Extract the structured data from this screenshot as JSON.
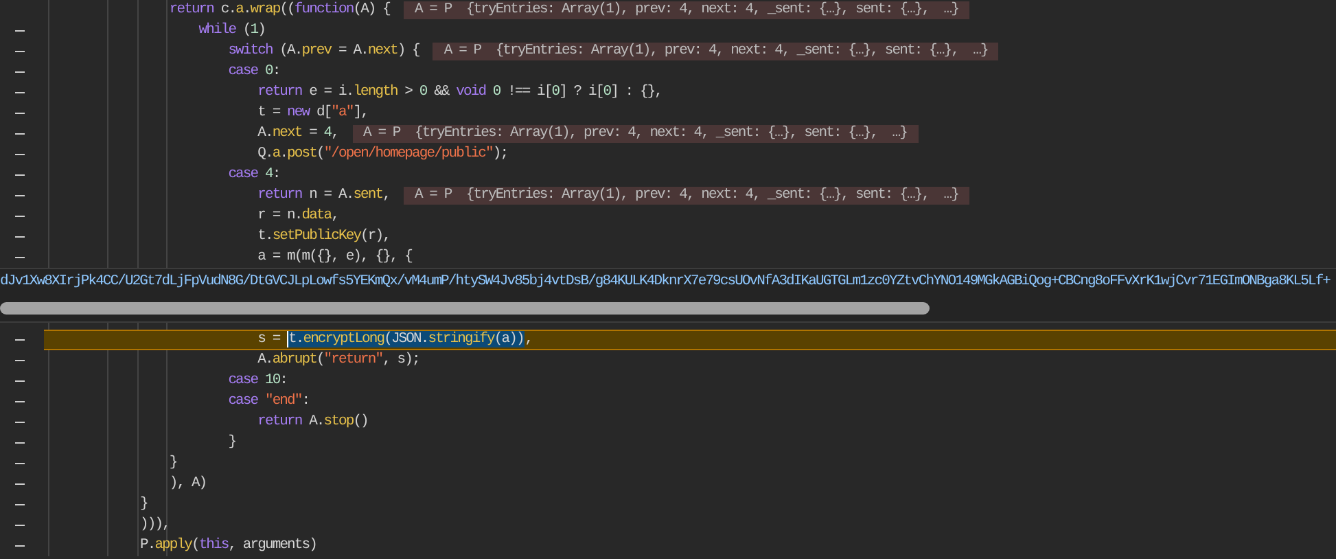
{
  "code_lines": [
    {
      "paused": false,
      "tokens": [
        {
          "kind": "keyword",
          "text": "        return"
        },
        {
          "kind": "plain",
          "text": " c."
        },
        {
          "kind": "property",
          "text": "a"
        },
        {
          "kind": "plain",
          "text": "."
        },
        {
          "kind": "property",
          "text": "wrap"
        },
        {
          "kind": "plain",
          "text": "(("
        },
        {
          "kind": "keyword",
          "text": "function"
        },
        {
          "kind": "plain",
          "text": "(A) {"
        }
      ],
      "hint": "A = P  {tryEntries: Array(1), prev: 4, next: 4, _sent: {…}, sent: {…},  …}"
    },
    {
      "breakable": true,
      "paused": false,
      "tokens": [
        {
          "kind": "keyword",
          "text": "            while"
        },
        {
          "kind": "plain",
          "text": " ("
        },
        {
          "kind": "number",
          "text": "1"
        },
        {
          "kind": "plain",
          "text": ")"
        }
      ]
    },
    {
      "breakable": true,
      "paused": false,
      "tokens": [
        {
          "kind": "keyword",
          "text": "                switch"
        },
        {
          "kind": "plain",
          "text": " (A."
        },
        {
          "kind": "property",
          "text": "prev"
        },
        {
          "kind": "plain",
          "text": " = A."
        },
        {
          "kind": "property",
          "text": "next"
        },
        {
          "kind": "plain",
          "text": ") {"
        }
      ],
      "hint": "A = P  {tryEntries: Array(1), prev: 4, next: 4, _sent: {…}, sent: {…},  …}"
    },
    {
      "breakable": true,
      "paused": false,
      "tokens": [
        {
          "kind": "keyword",
          "text": "                case "
        },
        {
          "kind": "number",
          "text": "0"
        },
        {
          "kind": "plain",
          "text": ":"
        }
      ]
    },
    {
      "breakable": true,
      "paused": false,
      "tokens": [
        {
          "kind": "keyword",
          "text": "                    return"
        },
        {
          "kind": "plain",
          "text": " e = i."
        },
        {
          "kind": "property",
          "text": "length"
        },
        {
          "kind": "plain",
          "text": " > "
        },
        {
          "kind": "number",
          "text": "0"
        },
        {
          "kind": "plain",
          "text": " && "
        },
        {
          "kind": "keyword",
          "text": "void "
        },
        {
          "kind": "number",
          "text": "0"
        },
        {
          "kind": "plain",
          "text": " !== i["
        },
        {
          "kind": "number",
          "text": "0"
        },
        {
          "kind": "plain",
          "text": "] ? i["
        },
        {
          "kind": "number",
          "text": "0"
        },
        {
          "kind": "plain",
          "text": "] : {},"
        }
      ]
    },
    {
      "breakable": true,
      "paused": false,
      "tokens": [
        {
          "kind": "plain",
          "text": "                    t = "
        },
        {
          "kind": "keyword",
          "text": "new"
        },
        {
          "kind": "plain",
          "text": " d["
        },
        {
          "kind": "string",
          "text": "\"a\""
        },
        {
          "kind": "plain",
          "text": "],"
        }
      ]
    },
    {
      "breakable": true,
      "paused": false,
      "tokens": [
        {
          "kind": "plain",
          "text": "                    A."
        },
        {
          "kind": "property",
          "text": "next"
        },
        {
          "kind": "plain",
          "text": " = "
        },
        {
          "kind": "number",
          "text": "4"
        },
        {
          "kind": "plain",
          "text": ","
        }
      ],
      "hint": "A = P  {tryEntries: Array(1), prev: 4, next: 4, _sent: {…}, sent: {…},  …}"
    },
    {
      "breakable": true,
      "paused": false,
      "tokens": [
        {
          "kind": "plain",
          "text": "                    Q."
        },
        {
          "kind": "property",
          "text": "a"
        },
        {
          "kind": "plain",
          "text": "."
        },
        {
          "kind": "property",
          "text": "post"
        },
        {
          "kind": "plain",
          "text": "("
        },
        {
          "kind": "string",
          "text": "\"/open/homepage/public\""
        },
        {
          "kind": "plain",
          "text": ");"
        }
      ]
    },
    {
      "breakable": true,
      "paused": false,
      "tokens": [
        {
          "kind": "keyword",
          "text": "                case "
        },
        {
          "kind": "number",
          "text": "4"
        },
        {
          "kind": "plain",
          "text": ":"
        }
      ]
    },
    {
      "breakable": true,
      "paused": false,
      "tokens": [
        {
          "kind": "keyword",
          "text": "                    return"
        },
        {
          "kind": "plain",
          "text": " n = A."
        },
        {
          "kind": "property",
          "text": "sent"
        },
        {
          "kind": "plain",
          "text": ","
        }
      ],
      "hint": "A = P  {tryEntries: Array(1), prev: 4, next: 4, _sent: {…}, sent: {…},  …}"
    },
    {
      "breakable": true,
      "paused": false,
      "tokens": [
        {
          "kind": "plain",
          "text": "                    r = n."
        },
        {
          "kind": "property",
          "text": "data"
        },
        {
          "kind": "plain",
          "text": ","
        }
      ]
    },
    {
      "breakable": true,
      "paused": false,
      "tokens": [
        {
          "kind": "plain",
          "text": "                    t."
        },
        {
          "kind": "property",
          "text": "setPublicKey"
        },
        {
          "kind": "plain",
          "text": "(r),"
        }
      ]
    },
    {
      "breakable": true,
      "paused": false,
      "tokens": [
        {
          "kind": "plain",
          "text": "                    a = m(m({}, e), {}, {"
        }
      ]
    },
    {
      "kind": "tooltip",
      "value": "dJv1Xw8XIrjPk4CC/U2Gt7dLjFpVudN8G/DtGVCJLpLowfs5YEKmQx/vM4umP/htySW4Jv85bj4vtDsB/g84KULK4DknrX7e79csUOvNfA3dIKaUGTGLm1zc0YZtvChYNO149MGkAGBiQog+CBCng8oFFvXrK1wjCvr71EGImONBga8KL5Lf+"
    },
    {
      "breakable": true,
      "paused": true,
      "tokens": [
        {
          "kind": "plain",
          "text": "                    s = "
        }
      ],
      "selection": [
        {
          "kind": "plain",
          "text": "t."
        },
        {
          "kind": "property",
          "text": "encryptLong"
        },
        {
          "kind": "plain",
          "text": "(JSON."
        },
        {
          "kind": "property",
          "text": "stringify"
        },
        {
          "kind": "plain",
          "text": "(a))"
        }
      ],
      "tokens_after": [
        {
          "kind": "plain",
          "text": ","
        }
      ]
    },
    {
      "breakable": true,
      "paused": false,
      "tokens": [
        {
          "kind": "plain",
          "text": "                    A."
        },
        {
          "kind": "property",
          "text": "abrupt"
        },
        {
          "kind": "plain",
          "text": "("
        },
        {
          "kind": "string",
          "text": "\"return\""
        },
        {
          "kind": "plain",
          "text": ", s);"
        }
      ]
    },
    {
      "breakable": true,
      "paused": false,
      "tokens": [
        {
          "kind": "keyword",
          "text": "                case "
        },
        {
          "kind": "number",
          "text": "10"
        },
        {
          "kind": "plain",
          "text": ":"
        }
      ]
    },
    {
      "breakable": true,
      "paused": false,
      "tokens": [
        {
          "kind": "keyword",
          "text": "                case "
        },
        {
          "kind": "string",
          "text": "\"end\""
        },
        {
          "kind": "plain",
          "text": ":"
        }
      ]
    },
    {
      "breakable": true,
      "paused": false,
      "tokens": [
        {
          "kind": "keyword",
          "text": "                    return"
        },
        {
          "kind": "plain",
          "text": " A."
        },
        {
          "kind": "property",
          "text": "stop"
        },
        {
          "kind": "plain",
          "text": "()"
        }
      ]
    },
    {
      "breakable": true,
      "paused": false,
      "tokens": [
        {
          "kind": "plain",
          "text": "                }"
        }
      ]
    },
    {
      "breakable": true,
      "paused": false,
      "tokens": [
        {
          "kind": "plain",
          "text": "        }"
        }
      ]
    },
    {
      "breakable": true,
      "paused": false,
      "tokens": [
        {
          "kind": "plain",
          "text": "        ), A)"
        }
      ]
    },
    {
      "breakable": true,
      "paused": false,
      "tokens": [
        {
          "kind": "plain",
          "text": "    }"
        }
      ]
    },
    {
      "breakable": true,
      "paused": false,
      "tokens": [
        {
          "kind": "plain",
          "text": "    ))),"
        }
      ]
    },
    {
      "breakable": true,
      "paused": false,
      "tokens": [
        {
          "kind": "plain",
          "text": "    P."
        },
        {
          "kind": "property",
          "text": "apply"
        },
        {
          "kind": "plain",
          "text": "("
        },
        {
          "kind": "keyword",
          "text": "this"
        },
        {
          "kind": "plain",
          "text": ", arguments)"
        }
      ]
    }
  ]
}
